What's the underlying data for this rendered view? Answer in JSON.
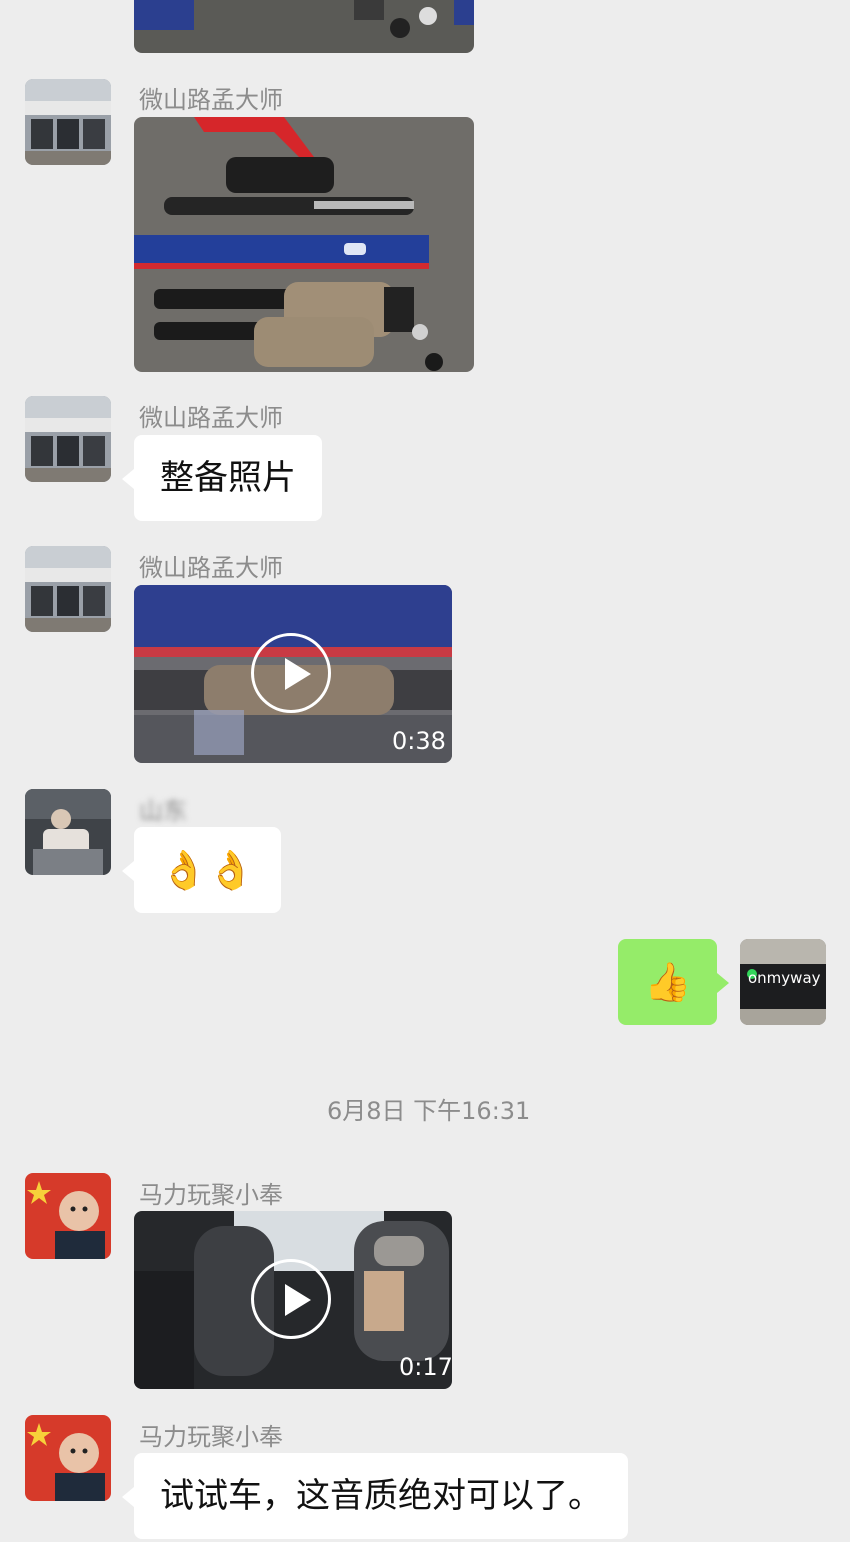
{
  "messages": [
    {
      "sender": "微山路孟大师",
      "type": "image",
      "description": "shock absorbers photo"
    },
    {
      "sender": "微山路孟大师",
      "type": "text",
      "text": "整备照片"
    },
    {
      "sender": "微山路孟大师",
      "type": "video",
      "duration": "0:38"
    },
    {
      "sender": "山东",
      "type": "emoji",
      "text": "👌👌"
    },
    {
      "sender": "me",
      "type": "emoji",
      "text": "👍"
    },
    {
      "sender": "马力玩聚小奉",
      "type": "video",
      "duration": "0:17"
    },
    {
      "sender": "马力玩聚小奉",
      "type": "text",
      "text": "试试车，这音质绝对可以了。"
    }
  ],
  "timestamp": "6月8日 下午16:31",
  "colors": {
    "background": "#ededed",
    "my_bubble": "#95ec69",
    "their_bubble": "#ffffff"
  }
}
